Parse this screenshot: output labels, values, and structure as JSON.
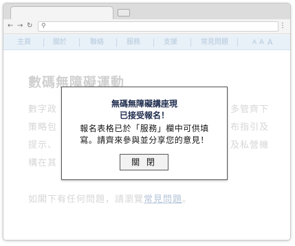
{
  "browser": {
    "back_icon": "arrow-left-icon",
    "forward_icon": "arrow-right-icon",
    "reload_icon": "reload-icon",
    "search_icon": "search-icon",
    "menu_icon": "more-vertical-icon",
    "address": ""
  },
  "navbar": {
    "items": [
      "主頁",
      "關於",
      "聯絡",
      "服務",
      "支援",
      "常見問題"
    ],
    "font_size_controls": [
      "A",
      "A",
      "A"
    ]
  },
  "page": {
    "title": "數碼無障礙運動",
    "paragraph_lines": [
      "數字政",
      "策略包",
      "提示、",
      "構在其"
    ],
    "paragraph_right": [
      "多管齊下",
      "布指引及",
      "及私營機",
      ""
    ],
    "faq_prefix": "如閣下有任何問題，請瀏覽",
    "faq_link": "常見問題",
    "faq_suffix": "。"
  },
  "dialog": {
    "title_line1": "無碼無障礙講座現",
    "title_line2": "已接受報名！",
    "body_line1": "報名表格已於「服務」欄中可供填",
    "body_line2": "寫。請齊來參與並分享您的意見！",
    "close_label": "關 閉"
  },
  "colors": {
    "navbar_bg": "#e8f0f8",
    "dialog_title": "#1d2b4c",
    "muted_text": "#d6d6d6"
  }
}
